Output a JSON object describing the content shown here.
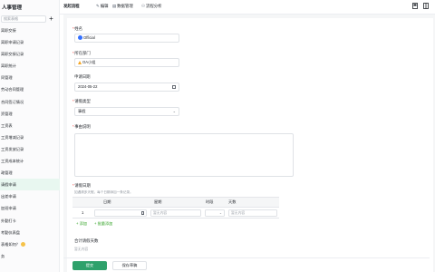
{
  "sidebar": {
    "title": "人事管理",
    "search_placeholder": "搜索表格",
    "items": [
      {
        "label": "离职交接"
      },
      {
        "label": "离职申请记录"
      },
      {
        "label": "离职交接记录"
      },
      {
        "label": "离职统计"
      },
      {
        "label": "同管理"
      },
      {
        "label": "劳动合同管理"
      },
      {
        "label": "合同签订情况"
      },
      {
        "label": "资管理"
      },
      {
        "label": "工资表"
      },
      {
        "label": "工资增减记录"
      },
      {
        "label": "工资发放记录"
      },
      {
        "label": "工资成本统计"
      },
      {
        "label": "政管理"
      },
      {
        "label": "请假申请"
      },
      {
        "label": "出差申请"
      },
      {
        "label": "加班申请"
      },
      {
        "label": "外勤打卡"
      },
      {
        "label": "考勤仪表盘"
      },
      {
        "label": "表格如何？"
      },
      {
        "label": "务"
      }
    ],
    "active_index": 13
  },
  "toolbar": {
    "items": [
      {
        "label": "发起流程",
        "icon": ""
      },
      {
        "label": "编辑",
        "icon": "edit-icon"
      },
      {
        "label": "数据管理",
        "icon": "data-manage-icon"
      },
      {
        "label": "流程分析",
        "icon": "flow-analysis-icon"
      }
    ]
  },
  "form": {
    "name": {
      "label": "姓名",
      "value": "Official"
    },
    "department": {
      "label": "所在部门",
      "value": "OA小组"
    },
    "apply_date": {
      "label": "申请日期",
      "value": "2024-05-22"
    },
    "leave_type": {
      "label": "请假类型",
      "value": "事假"
    },
    "reason": {
      "label": "事由说明",
      "value": ""
    },
    "detail": {
      "label": "请假日期",
      "hint": "如遇请多天假，每个日期添加一条记录。",
      "columns": [
        "日期",
        "星期",
        "时段",
        "天数"
      ],
      "rows": [
        {
          "index": "1",
          "date": "",
          "weekday_placeholder": "暂无内容",
          "period": "",
          "days_placeholder": "暂无内容"
        }
      ],
      "add_label": "添加",
      "batch_add_label": "批量添加"
    },
    "total_days": {
      "label": "合计请假天数",
      "placeholder": "暂无内容"
    }
  },
  "buttons": {
    "submit": "提交",
    "save_draft": "保存草稿"
  },
  "colors": {
    "primary": "#2ea16b",
    "required": "#f54a45",
    "active_bg": "#e8f7f0"
  }
}
